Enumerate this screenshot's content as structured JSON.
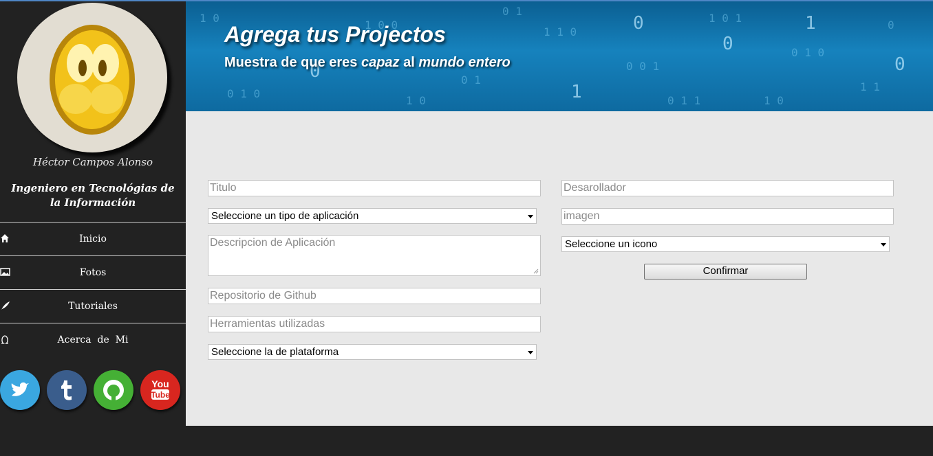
{
  "sidebar": {
    "name": "Héctor Campos Alonso",
    "role": "Ingeniero en Tecnológias de la Información",
    "nav": [
      {
        "label": "Inicio",
        "icon": "home-icon"
      },
      {
        "label": "Fotos",
        "icon": "image-icon"
      },
      {
        "label": "Tutoriales",
        "icon": "feather-icon"
      },
      {
        "label": "Acerca  de  Mi",
        "icon": "omega-icon"
      }
    ],
    "social": [
      {
        "name": "twitter-icon",
        "color": "#3aa7e0"
      },
      {
        "name": "tumblr-icon",
        "color": "#3a5d8c"
      },
      {
        "name": "github-icon",
        "color": "#45b035"
      },
      {
        "name": "youtube-icon",
        "color": "#d8261f"
      }
    ]
  },
  "banner": {
    "title": "Agrega tus Projectos",
    "sub_1": "Muestra de que eres ",
    "sub_2": "capaz",
    "sub_3": " al ",
    "sub_4": "mundo entero"
  },
  "form": {
    "titulo_placeholder": "Titulo",
    "tipo_select": "Seleccione un tipo de aplicación",
    "descripcion_placeholder": "Descripcion de Aplicación",
    "github_placeholder": "Repositorio de Github",
    "herramientas_placeholder": "Herramientas utilizadas",
    "plataforma_select": "Seleccione la de plataforma",
    "desarrollador_placeholder": "Desarollador",
    "imagen_placeholder": "imagen",
    "icono_select": "Seleccione un icono",
    "confirm_label": "Confirmar"
  }
}
